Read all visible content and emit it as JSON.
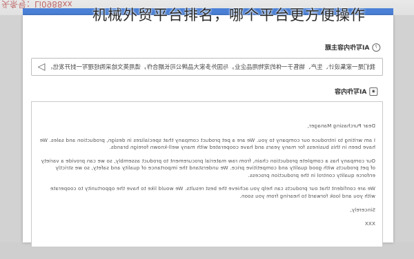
{
  "watermark": "头条号：Li0988xx",
  "overlay_title": "机械外贸平台排名，哪个平台更方便操作",
  "sections": {
    "theme": {
      "label": "AI写作内容主题",
      "icon": "help-circle-icon",
      "reference_text": "我们是一家集设计、生产、销售于一体的宠物用品企业，与国外多家大品牌公司长期合作，请用英文给采购经理写一封开发信。",
      "send_icon": "send-icon"
    },
    "content": {
      "label": "AI写作内容",
      "icon": "robot-icon"
    }
  },
  "letter": {
    "greeting": "Dear Purchasing Manager,",
    "p1": "I am writing to introduce our company to you. We are a pet product company that specializes in design, production and sales. We have been in this business for many years and have cooperated with many well-known foreign brands.",
    "p2": "Our company has a complete production chain, from raw material procurement to product assembly, so we can provide a variety of pet products with good quality and competitive price. We understand the importance of quality and safety, so we strictly enforce quality control in the production process.",
    "p3": "We are confident that our products can help you achieve the best results. We would like to have the opportunity to cooperate with you and look forward to hearing from you soon.",
    "closing": "Sincerely,",
    "signature": "XXX"
  }
}
